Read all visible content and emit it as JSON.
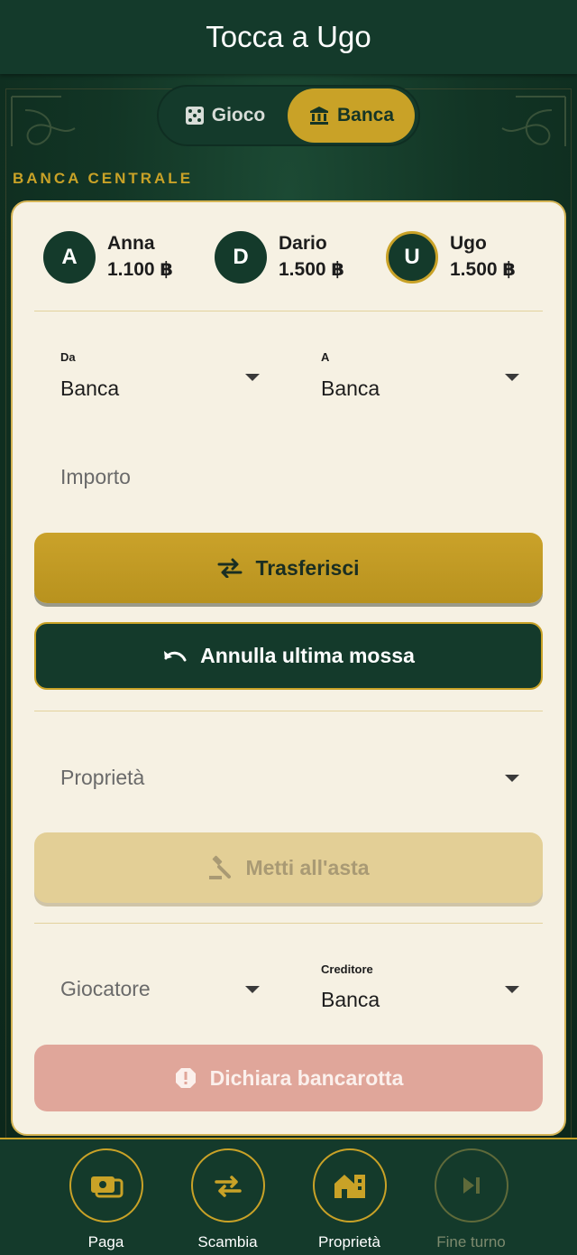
{
  "header": {
    "title": "Tocca a Ugo"
  },
  "mode_switch": {
    "game_label": "Gioco",
    "bank_label": "Banca",
    "selected": "Banca"
  },
  "section_label": "BANCA CENTRALE",
  "players": [
    {
      "initial": "A",
      "name": "Anna",
      "balance": "1.100 ฿",
      "active": false
    },
    {
      "initial": "D",
      "name": "Dario",
      "balance": "1.500 ฿",
      "active": false
    },
    {
      "initial": "U",
      "name": "Ugo",
      "balance": "1.500 ฿",
      "active": true
    }
  ],
  "transfer": {
    "from_label": "Da",
    "from_value": "Banca",
    "to_label": "A",
    "to_value": "Banca",
    "amount_placeholder": "Importo",
    "transfer_button": "Trasferisci",
    "undo_button": "Annulla ultima mossa"
  },
  "auction": {
    "property_placeholder": "Proprietà",
    "auction_button": "Metti all'asta"
  },
  "bankruptcy": {
    "player_placeholder": "Giocatore",
    "creditor_label": "Creditore",
    "creditor_value": "Banca",
    "bankrupt_button": "Dichiara bancarotta"
  },
  "bottom_nav": {
    "pay": "Paga",
    "trade": "Scambia",
    "properties": "Proprietà",
    "end_turn": "Fine turno"
  },
  "colors": {
    "primary": "#143a2b",
    "accent": "#c9a227",
    "card": "#f6f1e3",
    "danger_disabled": "#e0a69a"
  },
  "icons": {
    "game": "dice-icon",
    "bank": "bank-icon",
    "transfer": "swap-arrows-icon",
    "undo": "undo-icon",
    "auction": "gavel-icon",
    "bankrupt": "alert-circle-icon",
    "pay": "cash-icon",
    "trade": "swap-icon",
    "properties": "buildings-icon",
    "end_turn": "skip-next-icon"
  }
}
